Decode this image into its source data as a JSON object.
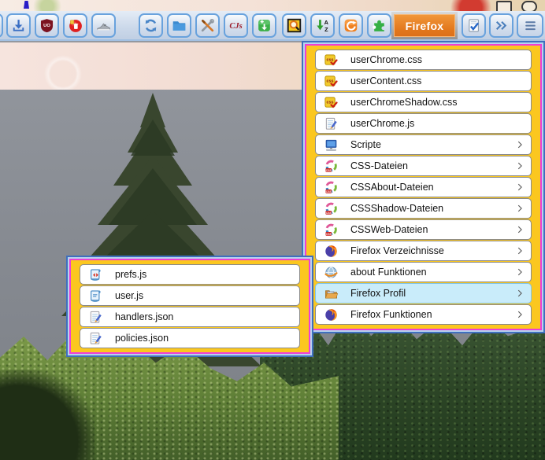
{
  "toolbar": {
    "firefox_button_label": "Firefox",
    "buttons": [
      {
        "icon": "download-icon"
      },
      {
        "icon": "ublock-shield-icon"
      },
      {
        "icon": "clear-cache-icon"
      },
      {
        "icon": "sneaker-icon"
      },
      {
        "icon": "sync-icon"
      },
      {
        "icon": "folder-icon"
      },
      {
        "icon": "tools-icon"
      },
      {
        "icon": "userchromejs-icon"
      },
      {
        "icon": "addon-install-icon"
      },
      {
        "icon": "page-search-icon"
      },
      {
        "icon": "sort-az-icon"
      },
      {
        "icon": "restart-icon"
      },
      {
        "icon": "puzzle-icon"
      },
      {
        "icon": "session-check-icon"
      },
      {
        "icon": "overflow-chevron-icon"
      },
      {
        "icon": "hamburger-menu-icon"
      }
    ]
  },
  "icons": {
    "ublock_text": "UO",
    "cjs_text": "CJs",
    "sort_a": "A",
    "sort_z": "Z",
    "css_badge": "css",
    "swirl_badge": "CSS"
  },
  "menu": {
    "items": [
      {
        "label": "userChrome.css",
        "icon": "css-file-icon",
        "has_submenu": false
      },
      {
        "label": "userContent.css",
        "icon": "css-file-icon",
        "has_submenu": false
      },
      {
        "label": "userChromeShadow.css",
        "icon": "css-file-icon",
        "has_submenu": false
      },
      {
        "label": "userChrome.js",
        "icon": "js-edit-icon",
        "has_submenu": false
      },
      {
        "label": "Scripte",
        "icon": "scripts-monitor-icon",
        "has_submenu": true
      },
      {
        "label": "CSS-Dateien",
        "icon": "css-swirl-icon",
        "has_submenu": true
      },
      {
        "label": "CSSAbout-Dateien",
        "icon": "css-swirl-icon",
        "has_submenu": true
      },
      {
        "label": "CSSShadow-Dateien",
        "icon": "css-swirl-icon",
        "has_submenu": true
      },
      {
        "label": "CSSWeb-Dateien",
        "icon": "css-swirl-icon",
        "has_submenu": true
      },
      {
        "label": "Firefox Verzeichnisse",
        "icon": "firefox-logo-icon",
        "has_submenu": true
      },
      {
        "label": "about Funktionen",
        "icon": "about-globe-icon",
        "has_submenu": true
      },
      {
        "label": "Firefox Profil",
        "icon": "profile-folder-icon",
        "has_submenu": true,
        "highlighted": true
      },
      {
        "label": "Firefox Funktionen",
        "icon": "firefox-logo-icon",
        "has_submenu": true
      }
    ]
  },
  "submenu": {
    "items": [
      {
        "label": "prefs.js",
        "icon": "prefs-scroll-icon"
      },
      {
        "label": "user.js",
        "icon": "user-scroll-icon"
      },
      {
        "label": "handlers.json",
        "icon": "js-edit-icon"
      },
      {
        "label": "policies.json",
        "icon": "js-edit-icon"
      }
    ]
  },
  "colors": {
    "firefox_button_orange": "#e2771c",
    "menu_gold": "#fbc71f",
    "menu_magenta": "#ee3ed6",
    "menu_border_blue": "#3f6fbe",
    "highlight_row": "#c9ecfa",
    "toolbar_button_border": "#69a2dd"
  }
}
